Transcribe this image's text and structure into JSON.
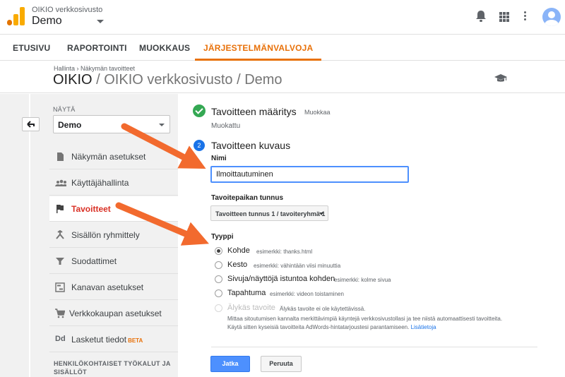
{
  "app": {
    "account": "OIKIO verkkosivusto",
    "view": "Demo"
  },
  "nav": {
    "tabs": [
      {
        "label": "ETUSIVU"
      },
      {
        "label": "RAPORTOINTI"
      },
      {
        "label": "MUOKKAUS"
      },
      {
        "label": "JÄRJESTELMÄNVALVOJA",
        "active": true
      }
    ]
  },
  "header": {
    "breadcrumb": "Hallinta › Näkymän tavoitteet",
    "title": "OIKIO",
    "subtitle": "/ OIKIO verkkosivusto / Demo"
  },
  "sidebar": {
    "view_label": "NÄYTÄ",
    "view_select": "Demo",
    "items": [
      {
        "label": "Näkymän asetukset",
        "icon": "document-icon"
      },
      {
        "label": "Käyttäjähallinta",
        "icon": "people-icon"
      },
      {
        "label": "Tavoitteet",
        "icon": "flag-icon",
        "active": true
      },
      {
        "label": "Sisällön ryhmittely",
        "icon": "grouping-icon"
      },
      {
        "label": "Suodattimet",
        "icon": "filter-icon"
      },
      {
        "label": "Kanavan asetukset",
        "icon": "channel-icon"
      },
      {
        "label": "Verkkokaupan asetukset",
        "icon": "cart-icon"
      },
      {
        "label": "Lasketut tiedot",
        "icon": "calculated-icon",
        "badge": "BETA"
      }
    ],
    "tools_heading": "HENKILÖKOHTAISET TYÖKALUT JA SISÄLLÖT"
  },
  "goal": {
    "step1": {
      "title": "Tavoitteen määritys",
      "edit": "Muokkaa",
      "status": "Muokattu"
    },
    "step2": {
      "number": "2",
      "title": "Tavoitteen kuvaus"
    },
    "name_label": "Nimi",
    "name_value": "Ilmoittautuminen",
    "slot_label": "Tavoitepaikan tunnus",
    "slot_value": "Tavoitteen tunnus 1 / tavoiteryhmä 1",
    "type_label": "Tyyppi",
    "types": [
      {
        "label": "Kohde",
        "example": "esimerkki: thanks.html",
        "checked": true
      },
      {
        "label": "Kesto",
        "example": "esimerkki: vähintään viisi minuuttia"
      },
      {
        "label": "Sivuja/näyttöjä istuntoa kohden",
        "example": "esimerkki: kolme sivua"
      },
      {
        "label": "Tapahtuma",
        "example": "esimerkki: videon toistaminen"
      },
      {
        "label": "Älykäs tavoite",
        "example": "Älykäs tavoite ei ole käytettävissä.",
        "disabled": true
      }
    ],
    "smart_desc_1": "Mittaa sitoutumisen kannalta merkittävimpiä käyntejä verkkosivustollasi ja tee niistä automaattisesti tavoitteita.",
    "smart_desc_2": "Käytä sitten kyseisiä tavoitteita AdWords-hintatarjoustesi parantamiseen.",
    "smart_link": "Lisätietoja",
    "continue": "Jatka",
    "cancel": "Peruuta"
  },
  "colors": {
    "accent": "#e8710a",
    "active_nav": "#d93025",
    "primary_button": "#4d90fe",
    "annotation_arrow": "#f26a2e"
  }
}
